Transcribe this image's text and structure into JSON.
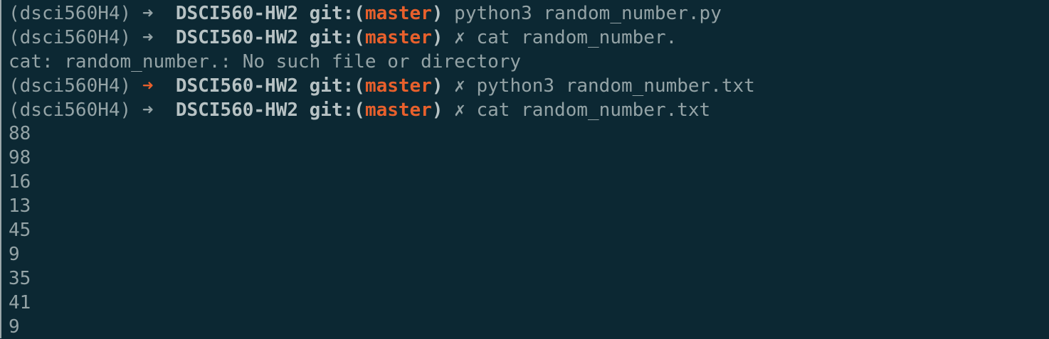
{
  "colors": {
    "background": "#0c2833",
    "text": "#94a3a6",
    "bold_text": "#b7c2c4",
    "accent": "#e8602c"
  },
  "prompts": [
    {
      "env": "(dsci560H4)",
      "arrow": "➜",
      "arrow_status": "ok",
      "dir": "DSCI560-HW2",
      "git_open": "git:(",
      "branch": "master",
      "git_close": ")",
      "dirty": "",
      "command": "python3 random_number.py"
    },
    {
      "env": "(dsci560H4)",
      "arrow": "➜",
      "arrow_status": "ok",
      "dir": "DSCI560-HW2",
      "git_open": "git:(",
      "branch": "master",
      "git_close": ")",
      "dirty": "✗",
      "command": "cat random_number."
    },
    {
      "env": "(dsci560H4)",
      "arrow": "➜",
      "arrow_status": "error",
      "dir": "DSCI560-HW2",
      "git_open": "git:(",
      "branch": "master",
      "git_close": ")",
      "dirty": "✗",
      "command": "python3 random_number.txt"
    },
    {
      "env": "(dsci560H4)",
      "arrow": "➜",
      "arrow_status": "ok",
      "dir": "DSCI560-HW2",
      "git_open": "git:(",
      "branch": "master",
      "git_close": ")",
      "dirty": "✗",
      "command": "cat random_number.txt"
    }
  ],
  "error_message": "cat: random_number.: No such file or directory",
  "output_numbers": [
    "88",
    "98",
    "16",
    "13",
    "45",
    "9",
    "35",
    "41",
    "9"
  ]
}
